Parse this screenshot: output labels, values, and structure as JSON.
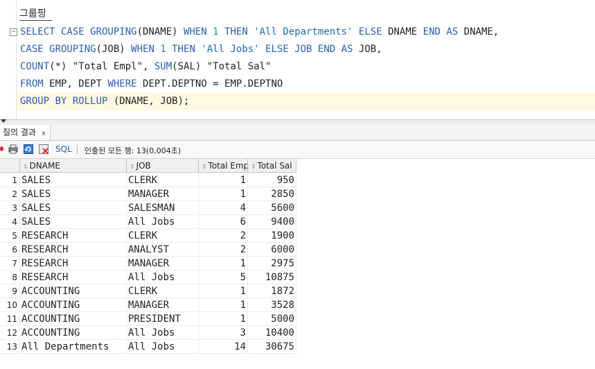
{
  "editor": {
    "comment": "그룹핑",
    "sql": {
      "l1": [
        {
          "t": "SELECT CASE GROUPING",
          "c": "kw"
        },
        {
          "t": "(DNAME) ",
          "c": "plain"
        },
        {
          "t": "WHEN ",
          "c": "kw"
        },
        {
          "t": "1 ",
          "c": "num"
        },
        {
          "t": "THEN ",
          "c": "kw"
        },
        {
          "t": "'All Departments' ",
          "c": "str"
        },
        {
          "t": "ELSE ",
          "c": "kw"
        },
        {
          "t": "DNAME ",
          "c": "plain"
        },
        {
          "t": "END AS ",
          "c": "kw"
        },
        {
          "t": "DNAME,",
          "c": "plain"
        }
      ],
      "l2": [
        {
          "t": "CASE GROUPING",
          "c": "kw"
        },
        {
          "t": "(JOB) ",
          "c": "plain"
        },
        {
          "t": "WHEN ",
          "c": "kw"
        },
        {
          "t": "1 ",
          "c": "num"
        },
        {
          "t": "THEN ",
          "c": "kw"
        },
        {
          "t": "'All Jobs' ",
          "c": "str"
        },
        {
          "t": "ELSE JOB END AS ",
          "c": "kw"
        },
        {
          "t": "JOB,",
          "c": "plain"
        }
      ],
      "l3": [
        {
          "t": "COUNT",
          "c": "kw"
        },
        {
          "t": "(*) \"Total Empl\", ",
          "c": "plain"
        },
        {
          "t": "SUM",
          "c": "kw"
        },
        {
          "t": "(SAL) \"Total Sal\"",
          "c": "plain"
        }
      ],
      "l4": [
        {
          "t": "FROM ",
          "c": "kw"
        },
        {
          "t": "EMP, DEPT ",
          "c": "plain"
        },
        {
          "t": "WHERE ",
          "c": "kw"
        },
        {
          "t": "DEPT.DEPTNO = EMP.DEPTNO",
          "c": "plain"
        }
      ],
      "l5": [
        {
          "t": "GROUP BY ROLLUP ",
          "c": "kw"
        },
        {
          "t": "(DNAME, JOB);",
          "c": "plain"
        }
      ]
    }
  },
  "results": {
    "tab_label": "질의 결과",
    "tab_close": "x",
    "toolbar": {
      "sql_label": "SQL",
      "status": "인출된 모든 행: 13(0,004초)"
    },
    "columns": [
      "DNAME",
      "JOB",
      "Total Empl",
      "Total Sal"
    ],
    "rows": [
      {
        "n": "1",
        "dname": "SALES",
        "job": "CLERK",
        "empl": "1",
        "sal": "950"
      },
      {
        "n": "2",
        "dname": "SALES",
        "job": "MANAGER",
        "empl": "1",
        "sal": "2850"
      },
      {
        "n": "3",
        "dname": "SALES",
        "job": "SALESMAN",
        "empl": "4",
        "sal": "5600"
      },
      {
        "n": "4",
        "dname": "SALES",
        "job": "All Jobs",
        "empl": "6",
        "sal": "9400"
      },
      {
        "n": "5",
        "dname": "RESEARCH",
        "job": "CLERK",
        "empl": "2",
        "sal": "1900"
      },
      {
        "n": "6",
        "dname": "RESEARCH",
        "job": "ANALYST",
        "empl": "2",
        "sal": "6000"
      },
      {
        "n": "7",
        "dname": "RESEARCH",
        "job": "MANAGER",
        "empl": "1",
        "sal": "2975"
      },
      {
        "n": "8",
        "dname": "RESEARCH",
        "job": "All Jobs",
        "empl": "5",
        "sal": "10875"
      },
      {
        "n": "9",
        "dname": "ACCOUNTING",
        "job": "CLERK",
        "empl": "1",
        "sal": "1872"
      },
      {
        "n": "10",
        "dname": "ACCOUNTING",
        "job": "MANAGER",
        "empl": "1",
        "sal": "3528"
      },
      {
        "n": "11",
        "dname": "ACCOUNTING",
        "job": "PRESIDENT",
        "empl": "1",
        "sal": "5000"
      },
      {
        "n": "12",
        "dname": "ACCOUNTING",
        "job": "All Jobs",
        "empl": "3",
        "sal": "10400"
      },
      {
        "n": "13",
        "dname": "All Departments",
        "job": "All Jobs",
        "empl": "14",
        "sal": "30675"
      }
    ]
  },
  "colors": {
    "keyword": "#2a5db0",
    "number": "#2a8f8f",
    "string": "#1f6bb0",
    "current_line": "#fff9e3"
  },
  "icons": [
    "pin-icon",
    "print-icon",
    "refresh-icon",
    "cancel-query-icon",
    "sort-icon",
    "fold-icon"
  ]
}
